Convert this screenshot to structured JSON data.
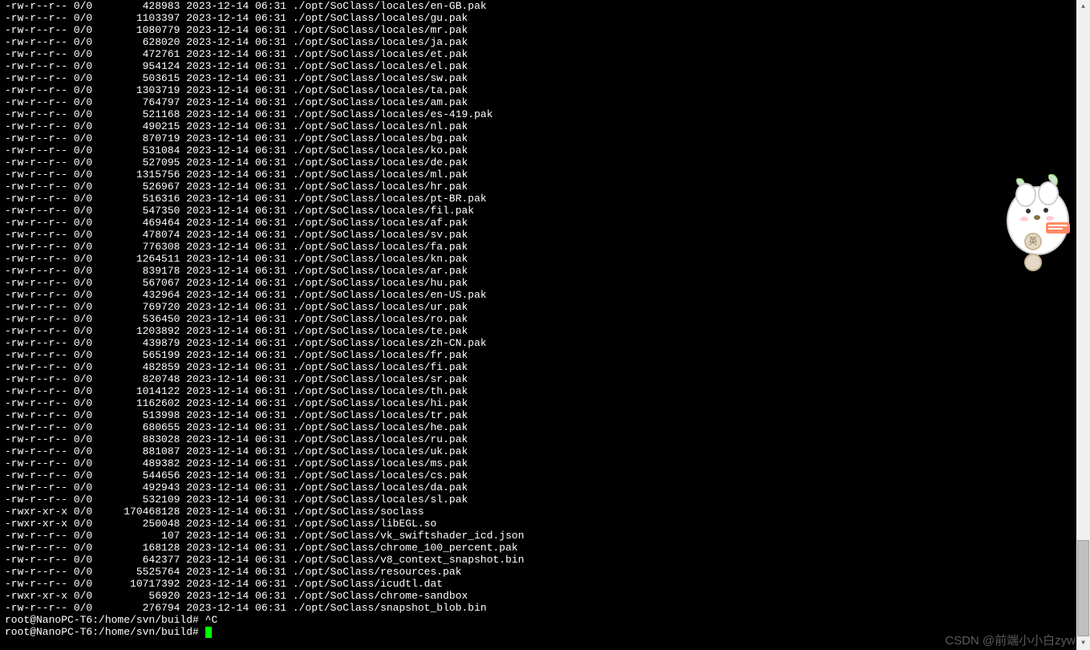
{
  "listing": [
    {
      "perm": "-rw-r--r--",
      "own": "0/0",
      "size": "428983",
      "date": "2023-12-14 06:31",
      "path": "./opt/SoClass/locales/en-GB.pak"
    },
    {
      "perm": "-rw-r--r--",
      "own": "0/0",
      "size": "1103397",
      "date": "2023-12-14 06:31",
      "path": "./opt/SoClass/locales/gu.pak"
    },
    {
      "perm": "-rw-r--r--",
      "own": "0/0",
      "size": "1080779",
      "date": "2023-12-14 06:31",
      "path": "./opt/SoClass/locales/mr.pak"
    },
    {
      "perm": "-rw-r--r--",
      "own": "0/0",
      "size": "628020",
      "date": "2023-12-14 06:31",
      "path": "./opt/SoClass/locales/ja.pak"
    },
    {
      "perm": "-rw-r--r--",
      "own": "0/0",
      "size": "472761",
      "date": "2023-12-14 06:31",
      "path": "./opt/SoClass/locales/et.pak"
    },
    {
      "perm": "-rw-r--r--",
      "own": "0/0",
      "size": "954124",
      "date": "2023-12-14 06:31",
      "path": "./opt/SoClass/locales/el.pak"
    },
    {
      "perm": "-rw-r--r--",
      "own": "0/0",
      "size": "503615",
      "date": "2023-12-14 06:31",
      "path": "./opt/SoClass/locales/sw.pak"
    },
    {
      "perm": "-rw-r--r--",
      "own": "0/0",
      "size": "1303719",
      "date": "2023-12-14 06:31",
      "path": "./opt/SoClass/locales/ta.pak"
    },
    {
      "perm": "-rw-r--r--",
      "own": "0/0",
      "size": "764797",
      "date": "2023-12-14 06:31",
      "path": "./opt/SoClass/locales/am.pak"
    },
    {
      "perm": "-rw-r--r--",
      "own": "0/0",
      "size": "521168",
      "date": "2023-12-14 06:31",
      "path": "./opt/SoClass/locales/es-419.pak"
    },
    {
      "perm": "-rw-r--r--",
      "own": "0/0",
      "size": "490215",
      "date": "2023-12-14 06:31",
      "path": "./opt/SoClass/locales/nl.pak"
    },
    {
      "perm": "-rw-r--r--",
      "own": "0/0",
      "size": "870719",
      "date": "2023-12-14 06:31",
      "path": "./opt/SoClass/locales/bg.pak"
    },
    {
      "perm": "-rw-r--r--",
      "own": "0/0",
      "size": "531084",
      "date": "2023-12-14 06:31",
      "path": "./opt/SoClass/locales/ko.pak"
    },
    {
      "perm": "-rw-r--r--",
      "own": "0/0",
      "size": "527095",
      "date": "2023-12-14 06:31",
      "path": "./opt/SoClass/locales/de.pak"
    },
    {
      "perm": "-rw-r--r--",
      "own": "0/0",
      "size": "1315756",
      "date": "2023-12-14 06:31",
      "path": "./opt/SoClass/locales/ml.pak"
    },
    {
      "perm": "-rw-r--r--",
      "own": "0/0",
      "size": "526967",
      "date": "2023-12-14 06:31",
      "path": "./opt/SoClass/locales/hr.pak"
    },
    {
      "perm": "-rw-r--r--",
      "own": "0/0",
      "size": "516316",
      "date": "2023-12-14 06:31",
      "path": "./opt/SoClass/locales/pt-BR.pak"
    },
    {
      "perm": "-rw-r--r--",
      "own": "0/0",
      "size": "547350",
      "date": "2023-12-14 06:31",
      "path": "./opt/SoClass/locales/fil.pak"
    },
    {
      "perm": "-rw-r--r--",
      "own": "0/0",
      "size": "469464",
      "date": "2023-12-14 06:31",
      "path": "./opt/SoClass/locales/af.pak"
    },
    {
      "perm": "-rw-r--r--",
      "own": "0/0",
      "size": "478074",
      "date": "2023-12-14 06:31",
      "path": "./opt/SoClass/locales/sv.pak"
    },
    {
      "perm": "-rw-r--r--",
      "own": "0/0",
      "size": "776308",
      "date": "2023-12-14 06:31",
      "path": "./opt/SoClass/locales/fa.pak"
    },
    {
      "perm": "-rw-r--r--",
      "own": "0/0",
      "size": "1264511",
      "date": "2023-12-14 06:31",
      "path": "./opt/SoClass/locales/kn.pak"
    },
    {
      "perm": "-rw-r--r--",
      "own": "0/0",
      "size": "839178",
      "date": "2023-12-14 06:31",
      "path": "./opt/SoClass/locales/ar.pak"
    },
    {
      "perm": "-rw-r--r--",
      "own": "0/0",
      "size": "567067",
      "date": "2023-12-14 06:31",
      "path": "./opt/SoClass/locales/hu.pak"
    },
    {
      "perm": "-rw-r--r--",
      "own": "0/0",
      "size": "432964",
      "date": "2023-12-14 06:31",
      "path": "./opt/SoClass/locales/en-US.pak"
    },
    {
      "perm": "-rw-r--r--",
      "own": "0/0",
      "size": "769720",
      "date": "2023-12-14 06:31",
      "path": "./opt/SoClass/locales/ur.pak"
    },
    {
      "perm": "-rw-r--r--",
      "own": "0/0",
      "size": "536450",
      "date": "2023-12-14 06:31",
      "path": "./opt/SoClass/locales/ro.pak"
    },
    {
      "perm": "-rw-r--r--",
      "own": "0/0",
      "size": "1203892",
      "date": "2023-12-14 06:31",
      "path": "./opt/SoClass/locales/te.pak"
    },
    {
      "perm": "-rw-r--r--",
      "own": "0/0",
      "size": "439879",
      "date": "2023-12-14 06:31",
      "path": "./opt/SoClass/locales/zh-CN.pak"
    },
    {
      "perm": "-rw-r--r--",
      "own": "0/0",
      "size": "565199",
      "date": "2023-12-14 06:31",
      "path": "./opt/SoClass/locales/fr.pak"
    },
    {
      "perm": "-rw-r--r--",
      "own": "0/0",
      "size": "482859",
      "date": "2023-12-14 06:31",
      "path": "./opt/SoClass/locales/fi.pak"
    },
    {
      "perm": "-rw-r--r--",
      "own": "0/0",
      "size": "820748",
      "date": "2023-12-14 06:31",
      "path": "./opt/SoClass/locales/sr.pak"
    },
    {
      "perm": "-rw-r--r--",
      "own": "0/0",
      "size": "1014122",
      "date": "2023-12-14 06:31",
      "path": "./opt/SoClass/locales/th.pak"
    },
    {
      "perm": "-rw-r--r--",
      "own": "0/0",
      "size": "1162602",
      "date": "2023-12-14 06:31",
      "path": "./opt/SoClass/locales/hi.pak"
    },
    {
      "perm": "-rw-r--r--",
      "own": "0/0",
      "size": "513998",
      "date": "2023-12-14 06:31",
      "path": "./opt/SoClass/locales/tr.pak"
    },
    {
      "perm": "-rw-r--r--",
      "own": "0/0",
      "size": "680655",
      "date": "2023-12-14 06:31",
      "path": "./opt/SoClass/locales/he.pak"
    },
    {
      "perm": "-rw-r--r--",
      "own": "0/0",
      "size": "883028",
      "date": "2023-12-14 06:31",
      "path": "./opt/SoClass/locales/ru.pak"
    },
    {
      "perm": "-rw-r--r--",
      "own": "0/0",
      "size": "881087",
      "date": "2023-12-14 06:31",
      "path": "./opt/SoClass/locales/uk.pak"
    },
    {
      "perm": "-rw-r--r--",
      "own": "0/0",
      "size": "489382",
      "date": "2023-12-14 06:31",
      "path": "./opt/SoClass/locales/ms.pak"
    },
    {
      "perm": "-rw-r--r--",
      "own": "0/0",
      "size": "544656",
      "date": "2023-12-14 06:31",
      "path": "./opt/SoClass/locales/cs.pak"
    },
    {
      "perm": "-rw-r--r--",
      "own": "0/0",
      "size": "492943",
      "date": "2023-12-14 06:31",
      "path": "./opt/SoClass/locales/da.pak"
    },
    {
      "perm": "-rw-r--r--",
      "own": "0/0",
      "size": "532109",
      "date": "2023-12-14 06:31",
      "path": "./opt/SoClass/locales/sl.pak"
    },
    {
      "perm": "-rwxr-xr-x",
      "own": "0/0",
      "size": "170468128",
      "date": "2023-12-14 06:31",
      "path": "./opt/SoClass/soclass"
    },
    {
      "perm": "-rwxr-xr-x",
      "own": "0/0",
      "size": "250048",
      "date": "2023-12-14 06:31",
      "path": "./opt/SoClass/libEGL.so"
    },
    {
      "perm": "-rw-r--r--",
      "own": "0/0",
      "size": "107",
      "date": "2023-12-14 06:31",
      "path": "./opt/SoClass/vk_swiftshader_icd.json"
    },
    {
      "perm": "-rw-r--r--",
      "own": "0/0",
      "size": "168128",
      "date": "2023-12-14 06:31",
      "path": "./opt/SoClass/chrome_100_percent.pak"
    },
    {
      "perm": "-rw-r--r--",
      "own": "0/0",
      "size": "642377",
      "date": "2023-12-14 06:31",
      "path": "./opt/SoClass/v8_context_snapshot.bin"
    },
    {
      "perm": "-rw-r--r--",
      "own": "0/0",
      "size": "5525764",
      "date": "2023-12-14 06:31",
      "path": "./opt/SoClass/resources.pak"
    },
    {
      "perm": "-rw-r--r--",
      "own": "0/0",
      "size": "10717392",
      "date": "2023-12-14 06:31",
      "path": "./opt/SoClass/icudtl.dat"
    },
    {
      "perm": "-rwxr-xr-x",
      "own": "0/0",
      "size": "56920",
      "date": "2023-12-14 06:31",
      "path": "./opt/SoClass/chrome-sandbox"
    },
    {
      "perm": "-rw-r--r--",
      "own": "0/0",
      "size": "276794",
      "date": "2023-12-14 06:31",
      "path": "./opt/SoClass/snapshot_blob.bin"
    }
  ],
  "prompt1": "root@NanoPC-T6:/home/svn/build# ^C",
  "prompt2": "root@NanoPC-T6:/home/svn/build# ",
  "ime_label": "英",
  "watermark": "CSDN @前端小小白zyw"
}
